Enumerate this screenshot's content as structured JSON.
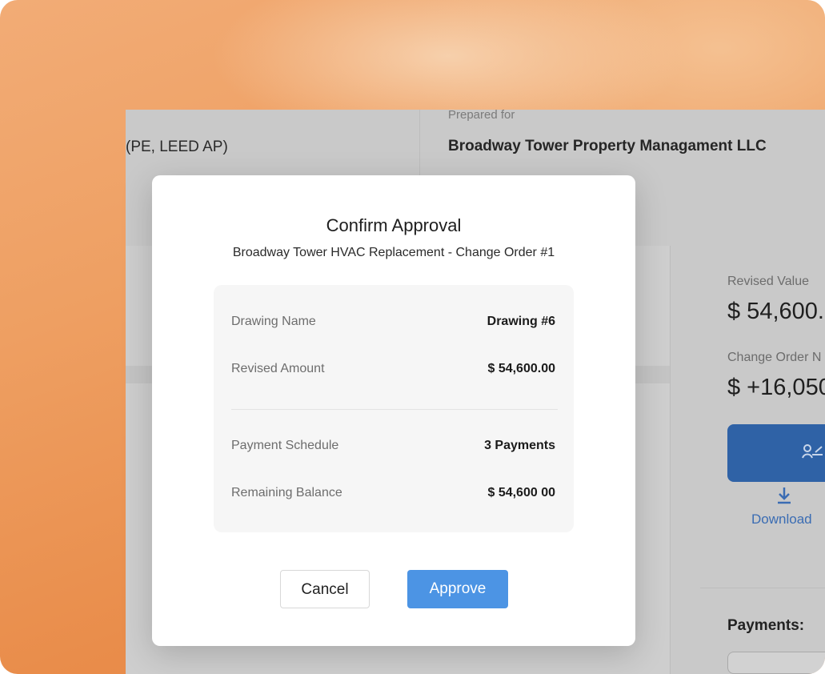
{
  "background_page": {
    "consultant_credentials": "(PE, LEED AP)",
    "prepared_for_label": "Prepared for",
    "client_name": "Broadway Tower Property Managament LLC",
    "sidebar": {
      "revised_value_label": "Revised Value",
      "revised_value": "$ 54,600.",
      "change_order_label": "Change Order N",
      "change_order_value": "$ +16,050",
      "download_label": "Download",
      "payments_label": "Payments:"
    }
  },
  "modal": {
    "title": "Confirm Approval",
    "subtitle": "Broadway Tower  HVAC Replacement - Change Order #1",
    "rows": [
      {
        "label": "Drawing Name",
        "value": "Drawing #6"
      },
      {
        "label": "Revised Amount",
        "value": "$ 54,600.00"
      },
      {
        "label": "Payment Schedule",
        "value": "3 Payments"
      },
      {
        "label": "Remaining Balance",
        "value": "$ 54,600 00"
      }
    ],
    "cancel_label": "Cancel",
    "approve_label": "Approve"
  },
  "colors": {
    "approve_button": "#4c94e4",
    "sign_button": "#2f62a6",
    "download_link": "#3a6cb3"
  },
  "icons": {
    "signature": "signature-icon",
    "download": "download-icon"
  }
}
